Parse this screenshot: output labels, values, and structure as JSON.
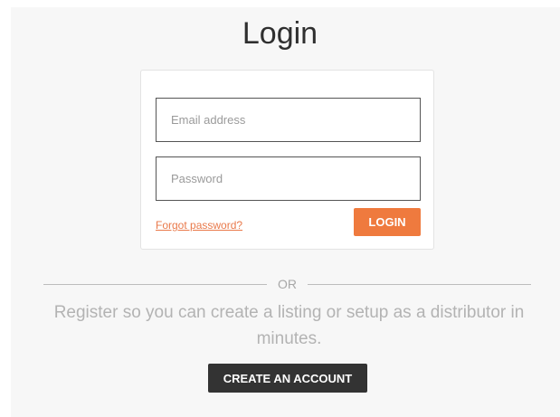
{
  "page": {
    "title": "Login"
  },
  "login_form": {
    "email_placeholder": "Email address",
    "password_placeholder": "Password",
    "forgot_label": "Forgot password?",
    "login_label": "LOGIN"
  },
  "divider": {
    "label": "OR"
  },
  "register": {
    "text": "Register so you can create a listing or setup as a distributor in minutes.",
    "button_label": "CREATE AN ACCOUNT"
  },
  "colors": {
    "accent": "#ef7a3e",
    "dark_button": "#333333",
    "panel_background": "#f7f7f7"
  }
}
